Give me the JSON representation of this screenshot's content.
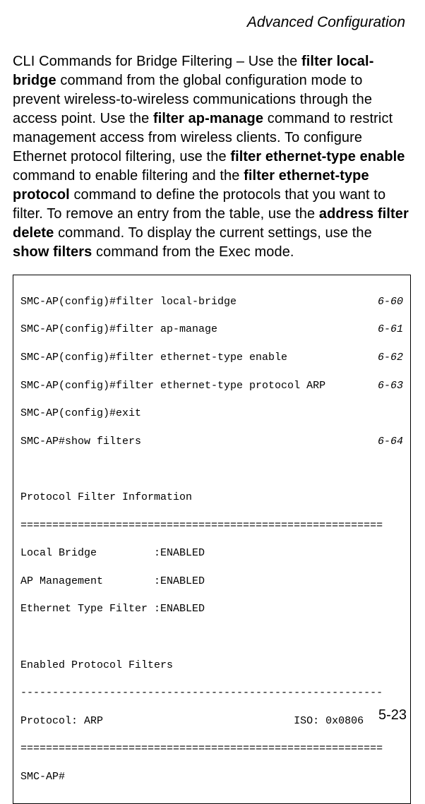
{
  "header": {
    "title": "Advanced Configuration"
  },
  "paragraph": {
    "t1": "CLI Commands for Bridge Filtering – Use the ",
    "b1": "filter local-bridge",
    "t2": " command from the global configuration mode to prevent wireless-to-wireless communications through the access point. Use the ",
    "b2": "filter ap-manage",
    "t3": " command to restrict management access from wireless clients. To configure Ethernet protocol filtering, use the ",
    "b3": "filter ethernet-type enable",
    "t4": " command to enable filtering and the ",
    "b4": "filter ethernet-type protocol",
    "t5": " command to define the protocols that you want to filter. To remove an entry from the table, use the ",
    "b5": "address filter delete",
    "t6": " command. To display the current settings, use the ",
    "b6": "show filters",
    "t7": " command from the Exec mode."
  },
  "cli": {
    "l1_cmd": "SMC-AP(config)#filter local-bridge",
    "l1_ref": "6-60",
    "l2_cmd": "SMC-AP(config)#filter ap-manage",
    "l2_ref": "6-61",
    "l3_cmd": "SMC-AP(config)#filter ethernet-type enable",
    "l3_ref": "6-62",
    "l4_cmd": "SMC-AP(config)#filter ethernet-type protocol ARP",
    "l4_ref": "6-63",
    "l5": "SMC-AP(config)#exit",
    "l6_cmd": "SMC-AP#show filters",
    "l6_ref": "6-64",
    "blank": " ",
    "l7": "Protocol Filter Information",
    "l8": "=========================================================",
    "l9": "Local Bridge         :ENABLED",
    "l10": "AP Management        :ENABLED",
    "l11": "Ethernet Type Filter :ENABLED",
    "l12": "Enabled Protocol Filters",
    "l13": "---------------------------------------------------------",
    "l14": "Protocol: ARP                              ISO: 0x0806",
    "l15": "=========================================================",
    "l16": "SMC-AP#"
  },
  "footer": {
    "page": "5-23"
  }
}
